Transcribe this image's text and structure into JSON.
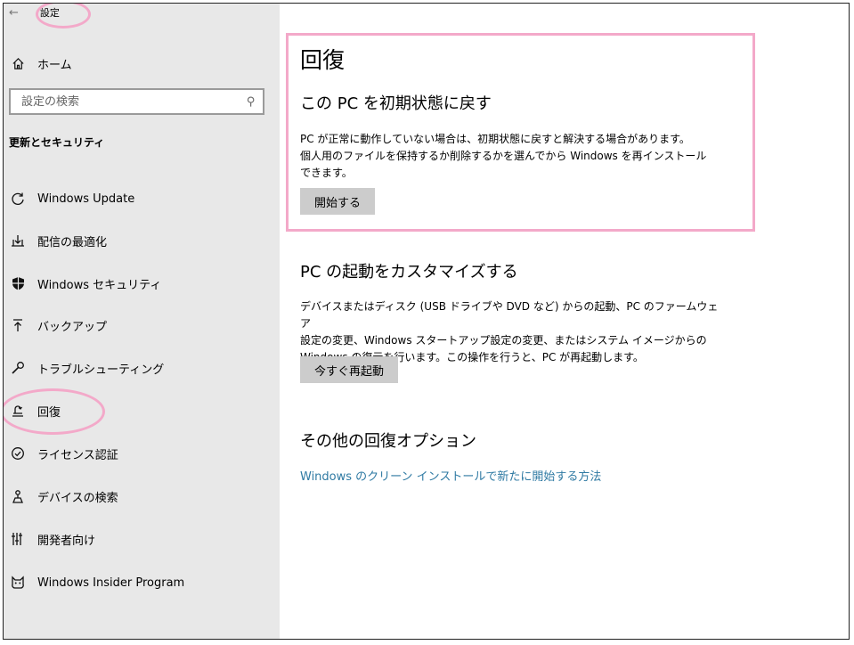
{
  "window": {
    "title": "設定",
    "back_icon": "←"
  },
  "sidebar": {
    "home_label": "ホーム",
    "search_placeholder": "設定の検索",
    "section_title": "更新とセキュリティ",
    "items": [
      {
        "label": "Windows Update",
        "icon": "refresh-icon"
      },
      {
        "label": "配信の最適化",
        "icon": "delivery-icon"
      },
      {
        "label": "Windows セキュリティ",
        "icon": "shield-icon"
      },
      {
        "label": "バックアップ",
        "icon": "backup-icon"
      },
      {
        "label": "トラブルシューティング",
        "icon": "wrench-icon"
      },
      {
        "label": "回復",
        "icon": "recovery-icon",
        "selected": true
      },
      {
        "label": "ライセンス認証",
        "icon": "check-circle-icon"
      },
      {
        "label": "デバイスの検索",
        "icon": "find-device-icon"
      },
      {
        "label": "開発者向け",
        "icon": "developer-icon"
      },
      {
        "label": "Windows Insider Program",
        "icon": "insider-icon"
      }
    ]
  },
  "main": {
    "page_title": "回復",
    "reset": {
      "heading": "この PC を初期状態に戻す",
      "desc_line1": "PC が正常に動作していない場合は、初期状態に戻すと解決する場合があります。",
      "desc_line2": "個人用のファイルを保持するか削除するかを選んでから Windows を再インストール",
      "desc_line3": "できます。",
      "button": "開始する"
    },
    "advanced": {
      "heading": "PC の起動をカスタマイズする",
      "desc_line1": "デバイスまたはディスク (USB ドライブや DVD など) からの起動、PC のファームウェア",
      "desc_line2": "設定の変更、Windows スタートアップ設定の変更、またはシステム イメージからの",
      "desc_line3": "Windows の復元を行います。この操作を行うと、PC が再起動します。",
      "button": "今すぐ再起動"
    },
    "more": {
      "heading": "その他の回復オプション",
      "link": "Windows のクリーン インストールで新たに開始する方法"
    }
  },
  "colors": {
    "highlight": "#f3a9c9",
    "link": "#2f7aa3",
    "sidebar_bg": "#e8e8e8",
    "button_bg": "#cccccc"
  }
}
